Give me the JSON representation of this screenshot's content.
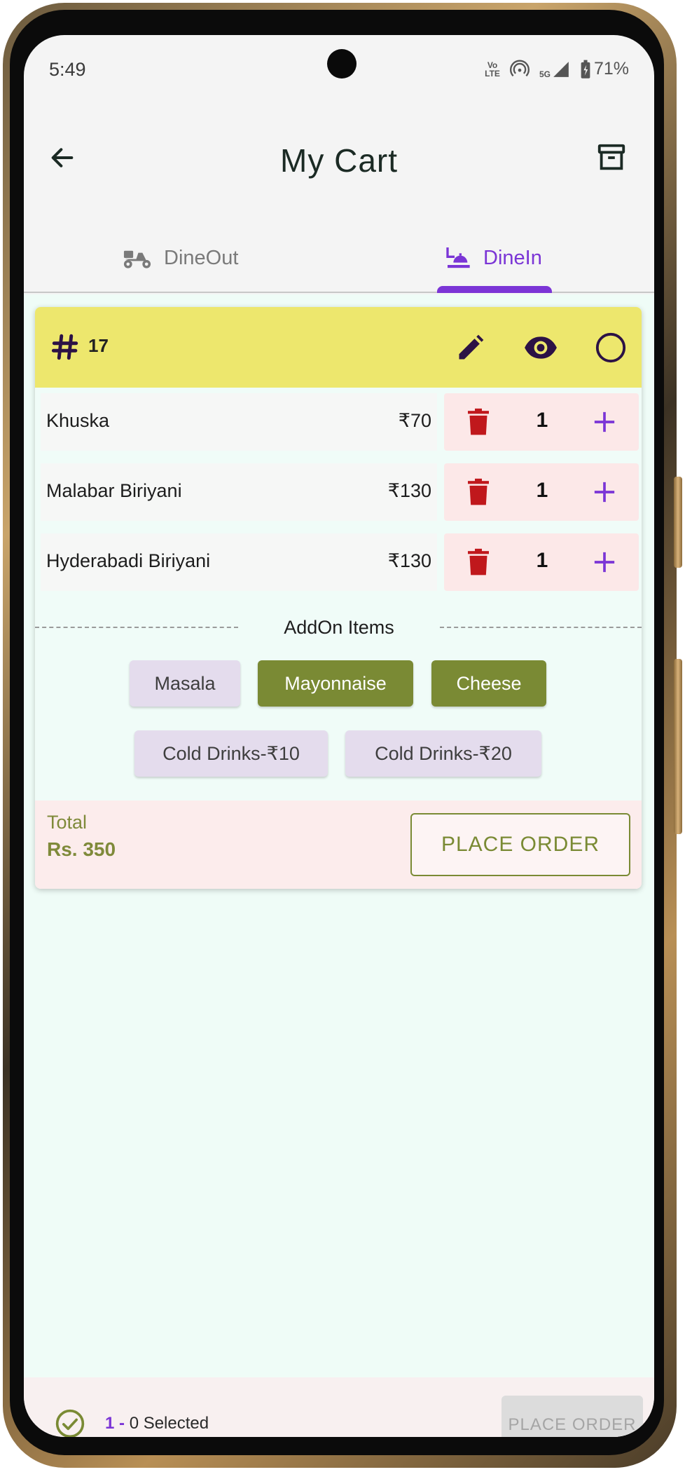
{
  "status_bar": {
    "time": "5:49",
    "volte": "Vo LTE",
    "network": "5G",
    "battery": "71%"
  },
  "app_bar": {
    "title": "My Cart"
  },
  "tabs": [
    {
      "label": "DineOut",
      "active": false
    },
    {
      "label": "DineIn",
      "active": true
    }
  ],
  "order_card": {
    "table_number": "17",
    "items": [
      {
        "name": "Khuska",
        "price": "₹70",
        "qty": "1"
      },
      {
        "name": "Malabar Biriyani",
        "price": "₹130",
        "qty": "1"
      },
      {
        "name": "Hyderabadi Biriyani",
        "price": "₹130",
        "qty": "1"
      }
    ],
    "addons_title": "AddOn Items",
    "addons": [
      {
        "label": "Masala",
        "selected": false
      },
      {
        "label": "Mayonnaise",
        "selected": true
      },
      {
        "label": "Cheese",
        "selected": true
      },
      {
        "label": "Cold Drinks-₹10",
        "selected": false
      },
      {
        "label": "Cold Drinks-₹20",
        "selected": false
      }
    ],
    "total_label": "Total",
    "total_value": "Rs. 350",
    "place_order_label": "PLACE ORDER"
  },
  "bottom_bar": {
    "selected_count": "1 - ",
    "selected_label": "0 Selected",
    "place_order_label": "PLACE ORDER"
  },
  "colors": {
    "accent": "#7b35d6",
    "header_yellow": "#ede76d",
    "olive": "#7a8a34",
    "delete_red": "#c0181c",
    "content_bg": "#effcf7"
  }
}
